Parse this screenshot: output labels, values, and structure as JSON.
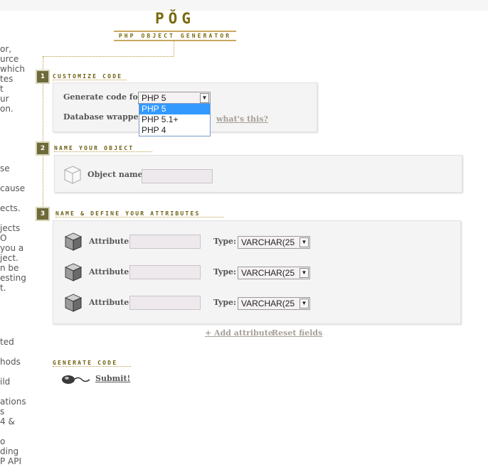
{
  "logo": {
    "word": "PŎG",
    "subtitle": "PHP OBJECT GENERATOR"
  },
  "left_fragments": [
    "or,",
    "urce",
    "which",
    "tes",
    "t",
    "ur",
    "on.",
    "se",
    "cause",
    "ects.",
    "jects",
    "O",
    "you a",
    "ject.",
    "n be",
    "esting",
    "t.",
    "ted",
    "hods",
    "ild",
    "ations",
    "s",
    "4 &",
    "o",
    "ding",
    "P API"
  ],
  "step1": {
    "number": "1",
    "title": "CUSTOMIZE CODE",
    "generate_label": "Generate code for:",
    "generate_value": "PHP 5",
    "wrapper_label": "Database wrapper:",
    "whats_this": "what's this?",
    "dropdown_options": [
      "PHP 5",
      "PHP 5.1+",
      "PHP 4"
    ]
  },
  "step2": {
    "number": "2",
    "title": "NAME YOUR OBJECT",
    "object_name_label": "Object name:",
    "object_name_value": ""
  },
  "step3": {
    "number": "3",
    "title": "NAME & DEFINE YOUR ATTRIBUTES",
    "attributes": [
      {
        "label": "Attribute:",
        "value": "",
        "type_label": "Type:",
        "type_value": "VARCHAR(25"
      },
      {
        "label": "Attribute:",
        "value": "",
        "type_label": "Type:",
        "type_value": "VARCHAR(25"
      },
      {
        "label": "Attribute:",
        "value": "",
        "type_label": "Type:",
        "type_value": "VARCHAR(25"
      }
    ],
    "add_attribute": "+ Add attribute",
    "reset_fields": "Reset fields"
  },
  "generate": {
    "title": "GENERATE CODE",
    "submit": "Submit!"
  },
  "colors": {
    "accent": "#6b5e10",
    "step_badge": "#6e6a3a",
    "panel_bg": "#f4f4f4",
    "selected": "#3399ff"
  }
}
